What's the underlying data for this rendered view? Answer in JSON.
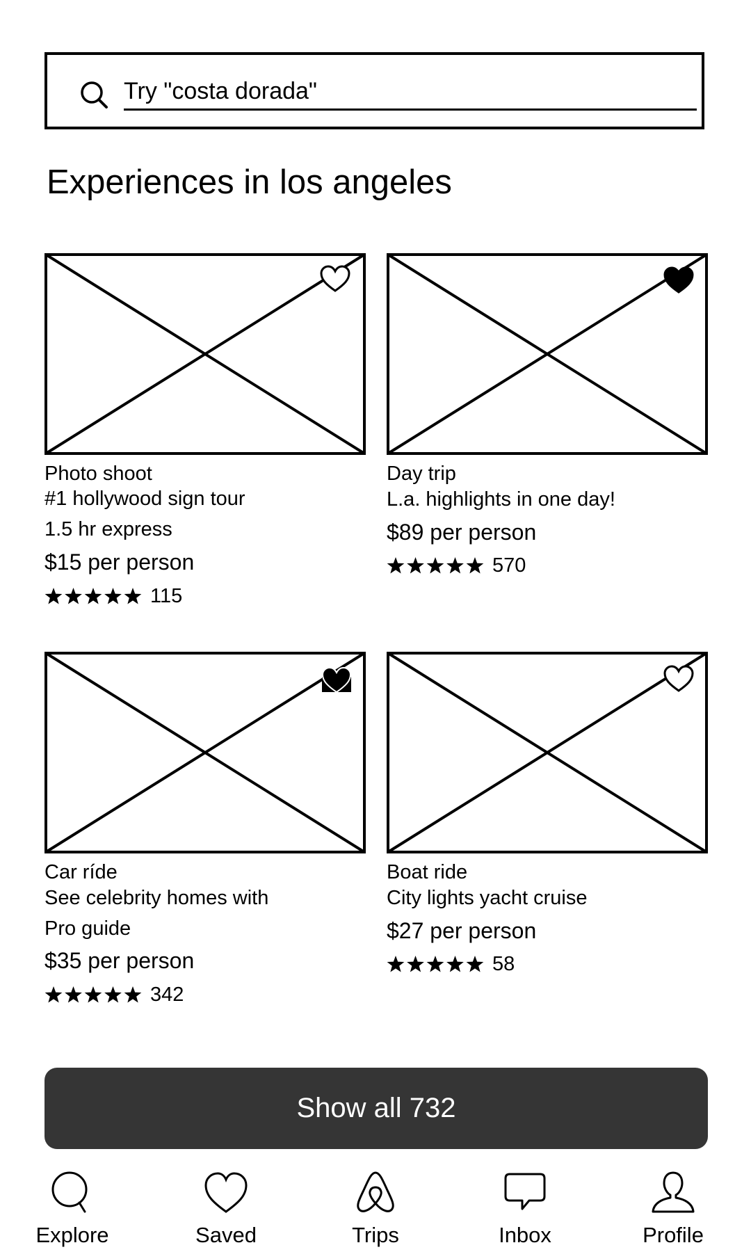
{
  "search": {
    "placeholder": "Try \"costa dorada\"",
    "icon": "search-icon"
  },
  "page_title": "Experiences in los angeles",
  "cards": [
    {
      "category": "Photo shoot",
      "title_lines": [
        "#1 hollywood sign tour",
        "1.5 hr express"
      ],
      "price": "$15 per person",
      "stars": 5,
      "reviews": "115",
      "saved": false
    },
    {
      "category": "Day trip",
      "title_lines": [
        "L.a. highlights in one day!"
      ],
      "price": "$89 per person",
      "stars": 5,
      "reviews": "570",
      "saved": true
    },
    {
      "category": "Car ríde",
      "title_lines": [
        "See celebrity homes with",
        "Pro guide"
      ],
      "price": "$35 per person",
      "stars": 5,
      "reviews": "342",
      "saved": true
    },
    {
      "category": "Boat ride",
      "title_lines": [
        "City lights yacht cruise"
      ],
      "price": "$27 per person",
      "stars": 5,
      "reviews": "58",
      "saved": false
    }
  ],
  "show_all_label": "Show all 732",
  "nav": [
    {
      "label": "Explore",
      "icon": "search-icon"
    },
    {
      "label": "Saved",
      "icon": "heart-icon"
    },
    {
      "label": "Trips",
      "icon": "trips-logo-icon"
    },
    {
      "label": "Inbox",
      "icon": "chat-bubble-icon"
    },
    {
      "label": "Profile",
      "icon": "person-icon"
    }
  ],
  "colors": {
    "button_background": "#353535",
    "button_text": "#ffffff",
    "ink": "#000000"
  }
}
